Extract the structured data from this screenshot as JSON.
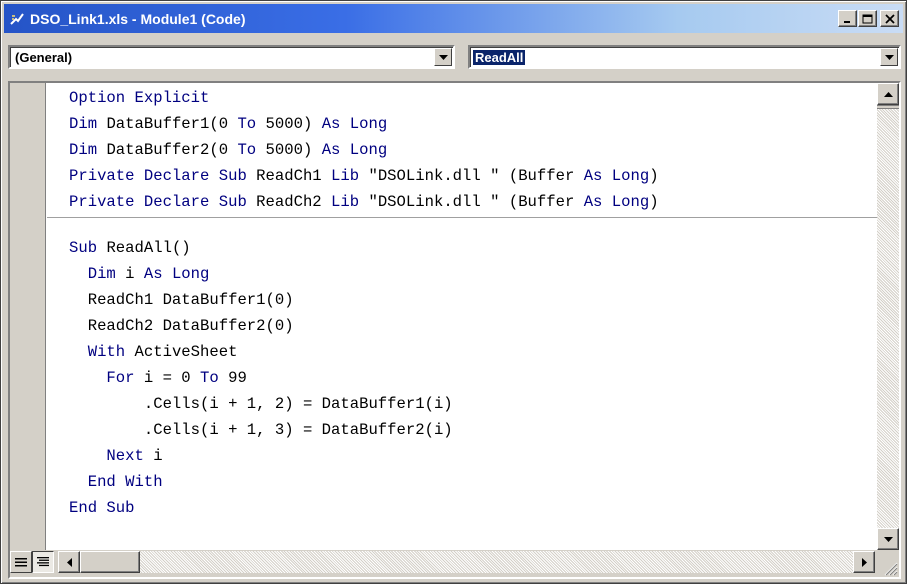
{
  "window": {
    "title": "DSO_Link1.xls - Module1 (Code)",
    "icon": "vba-module-icon",
    "controls": [
      "minimize",
      "maximize",
      "close"
    ]
  },
  "object_combo": {
    "value": "(General)"
  },
  "procedure_combo": {
    "value": "ReadAll"
  },
  "colors": {
    "keyword": "#000080",
    "text": "#000000",
    "title_gradient_start": "#2554c7",
    "title_gradient_end": "#c9dcf5",
    "chrome": "#d4d0c8"
  },
  "code": {
    "declarations": [
      [
        {
          "t": "Option Explicit",
          "k": 1
        }
      ],
      [
        {
          "t": "Dim ",
          "k": 1
        },
        {
          "t": "DataBuffer1(0 ",
          "k": 0
        },
        {
          "t": "To",
          "k": 1
        },
        {
          "t": " 5000) ",
          "k": 0
        },
        {
          "t": "As Long",
          "k": 1
        }
      ],
      [
        {
          "t": "Dim ",
          "k": 1
        },
        {
          "t": "DataBuffer2(0 ",
          "k": 0
        },
        {
          "t": "To",
          "k": 1
        },
        {
          "t": " 5000) ",
          "k": 0
        },
        {
          "t": "As Long",
          "k": 1
        }
      ],
      [
        {
          "t": "Private Declare Sub ",
          "k": 1
        },
        {
          "t": "ReadCh1 ",
          "k": 0
        },
        {
          "t": "Lib",
          "k": 1
        },
        {
          "t": " \"DSOLink.dll \" (Buffer ",
          "k": 0
        },
        {
          "t": "As Long",
          "k": 1
        },
        {
          "t": ")",
          "k": 0
        }
      ],
      [
        {
          "t": "Private Declare Sub ",
          "k": 1
        },
        {
          "t": "ReadCh2 ",
          "k": 0
        },
        {
          "t": "Lib",
          "k": 1
        },
        {
          "t": " \"DSOLink.dll \" (Buffer ",
          "k": 0
        },
        {
          "t": "As Long",
          "k": 1
        },
        {
          "t": ")",
          "k": 0
        }
      ]
    ],
    "procedure": [
      [
        {
          "t": "Sub ",
          "k": 1
        },
        {
          "t": "ReadAll()",
          "k": 0
        }
      ],
      [
        {
          "t": "  Dim ",
          "k": 1
        },
        {
          "t": "i ",
          "k": 0
        },
        {
          "t": "As Long",
          "k": 1
        }
      ],
      [
        {
          "t": "  ReadCh1 DataBuffer1(0)",
          "k": 0
        }
      ],
      [
        {
          "t": "  ReadCh2 DataBuffer2(0)",
          "k": 0
        }
      ],
      [
        {
          "t": "  With ",
          "k": 1
        },
        {
          "t": "ActiveSheet",
          "k": 0
        }
      ],
      [
        {
          "t": "    For ",
          "k": 1
        },
        {
          "t": "i = 0 ",
          "k": 0
        },
        {
          "t": "To",
          "k": 1
        },
        {
          "t": " 99",
          "k": 0
        }
      ],
      [
        {
          "t": "        .Cells(i + 1, 2) = DataBuffer1(i)",
          "k": 0
        }
      ],
      [
        {
          "t": "        .Cells(i + 1, 3) = DataBuffer2(i)",
          "k": 0
        }
      ],
      [
        {
          "t": "    Next ",
          "k": 1
        },
        {
          "t": "i",
          "k": 0
        }
      ],
      [
        {
          "t": "  End With",
          "k": 1
        }
      ],
      [
        {
          "t": "End Sub",
          "k": 1
        }
      ]
    ]
  },
  "icons": {
    "combo_arrow": "chevron-down-icon",
    "scroll_up": "arrow-up-icon",
    "scroll_down": "arrow-down-icon",
    "scroll_left": "arrow-left-icon",
    "scroll_right": "arrow-right-icon",
    "procedure_view": "procedure-view-icon",
    "full_module_view": "full-module-view-icon",
    "size_grip": "size-grip-icon"
  }
}
